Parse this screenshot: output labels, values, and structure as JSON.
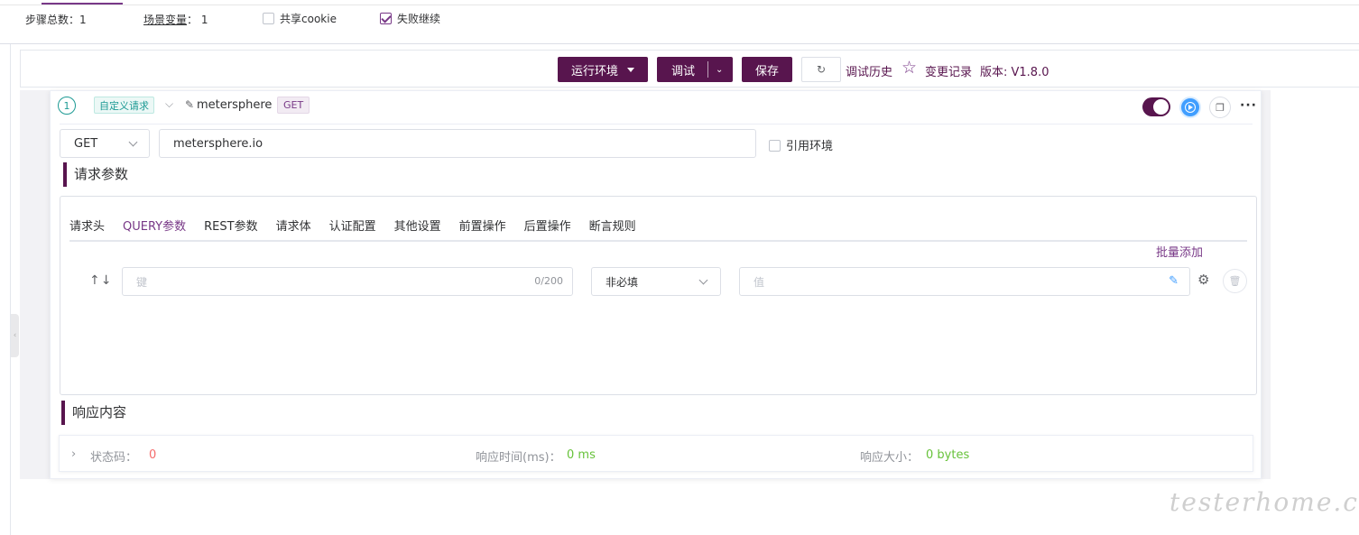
{
  "toolbar": {
    "step_total_label": "步骤总数：",
    "step_total_value": "1",
    "scene_var_label": "场景变量",
    "scene_var_colon": "：",
    "scene_var_value": "1",
    "share_cookie_label": "共享cookie",
    "share_cookie_checked": false,
    "fail_continue_label": "失败继续",
    "fail_continue_checked": true,
    "run_env_label": "运行环境",
    "debug_label": "调试",
    "save_label": "保存",
    "debug_history_label": "调试历史",
    "change_record_label": "变更记录",
    "version_label": "版本: V1.8.0"
  },
  "step": {
    "index": "1",
    "type_tag": "自定义请求",
    "name": "metersphere",
    "method_tag": "GET",
    "enabled": true
  },
  "request": {
    "method": "GET",
    "url": "metersphere.io",
    "use_env_label": "引用环境",
    "use_env_checked": false
  },
  "params_section": {
    "title": "请求参数",
    "tabs": [
      {
        "label": "请求头",
        "active": false
      },
      {
        "label": "QUERY参数",
        "active": true
      },
      {
        "label": "REST参数",
        "active": false
      },
      {
        "label": "请求体",
        "active": false
      },
      {
        "label": "认证配置",
        "active": false
      },
      {
        "label": "其他设置",
        "active": false
      },
      {
        "label": "前置操作",
        "active": false
      },
      {
        "label": "后置操作",
        "active": false
      },
      {
        "label": "断言规则",
        "active": false
      }
    ],
    "batch_add_label": "批量添加",
    "row": {
      "key_placeholder": "键",
      "key_count": "0/200",
      "required_value": "非必填",
      "value_placeholder": "值"
    }
  },
  "response_section": {
    "title": "响应内容",
    "status_label": "状态码：",
    "status_value": "0",
    "time_label": "响应时间(ms)：",
    "time_value": "0 ms",
    "size_label": "响应大小：",
    "size_value": "0 bytes"
  },
  "watermark": "testerhome.com",
  "colors": {
    "brand": "#58154e",
    "accent": "#783887",
    "link_blue": "#409eff",
    "status_red": "#f56c6c",
    "success_green": "#67c23a"
  }
}
